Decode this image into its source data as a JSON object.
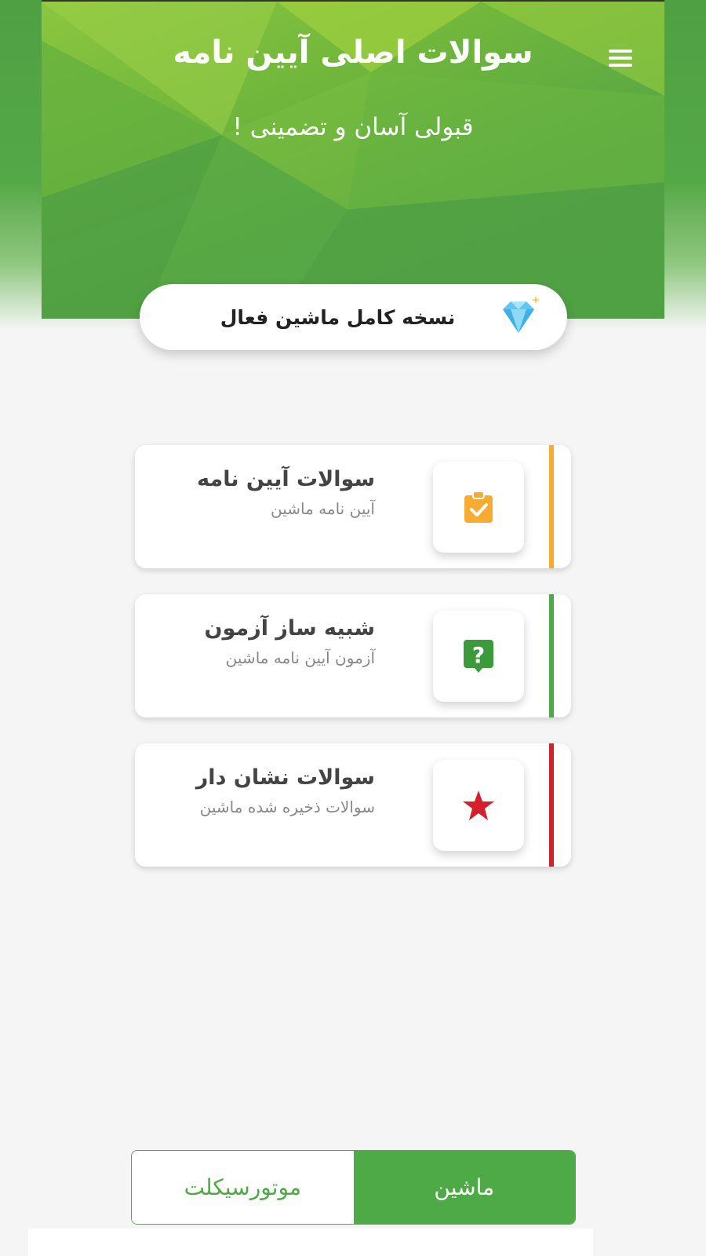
{
  "header": {
    "title": "سوالات اصلی آیین نامه",
    "subtitle": "قبولی آسان و تضمینی !",
    "menu_icon": "hamburger-menu-icon"
  },
  "premium": {
    "label": "نسخه کامل ماشین فعال",
    "icon": "diamond-icon"
  },
  "cards": [
    {
      "title": "سوالات آیین نامه",
      "subtitle": "آیین نامه ماشین",
      "icon": "clipboard-check-icon",
      "accent": "#f7ac31"
    },
    {
      "title": "شبیه ساز آزمون",
      "subtitle": "آزمون آیین نامه ماشین",
      "icon": "question-mark-icon",
      "accent": "#4eaa47"
    },
    {
      "title": "سوالات نشان دار",
      "subtitle": "سوالات ذخیره شده ماشین",
      "icon": "star-icon",
      "accent": "#d3202b"
    }
  ],
  "tabs": {
    "motorcycle": "موتورسیکلت",
    "car": "ماشین",
    "selected": "car"
  },
  "colors": {
    "primary_green": "#4eaa47",
    "header_light_green": "#8cc63f",
    "background": "#f5f5f5"
  }
}
